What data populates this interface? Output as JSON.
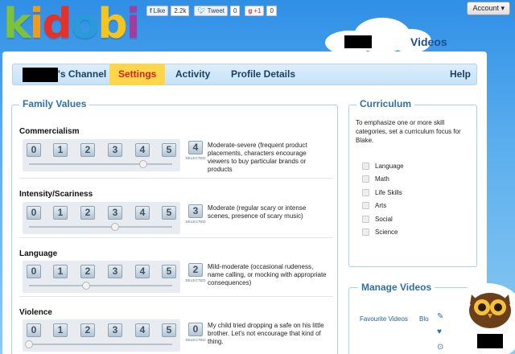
{
  "brand": {
    "letters": [
      "k",
      "i",
      "d",
      "o",
      "b",
      "i"
    ],
    "colors": [
      "#7cc23a",
      "#f29a1d",
      "#e4322b",
      "#2a9ad8",
      "#f4c51f",
      "#a43c9f"
    ]
  },
  "social": {
    "like_label": "Like",
    "like_count": "2.2k",
    "tweet_label": "Tweet",
    "tweet_count": "0",
    "gplus_label": "+1",
    "gplus_count": "0"
  },
  "header": {
    "account_label": "Account ▾",
    "section_title": "Videos"
  },
  "tabs": [
    {
      "label": "'s Channel",
      "active": false
    },
    {
      "label": "Settings",
      "active": true
    },
    {
      "label": "Activity",
      "active": false
    },
    {
      "label": "Profile Details",
      "active": false
    },
    {
      "label": "Help",
      "active": false
    }
  ],
  "family_values": {
    "title": "Family Values",
    "scale_numbers": [
      "0",
      "1",
      "2",
      "3",
      "4",
      "5"
    ],
    "selected_label": "SELECTED",
    "categories": [
      {
        "name": "Commercialism",
        "value": "4",
        "level": 0.8,
        "description": "Moderate-severe (frequent product placements, characters encourage viewers to buy particular brands or products"
      },
      {
        "name": "Intensity/Scariness",
        "value": "3",
        "level": 0.6,
        "description": "Moderate (regular scary or intense scenes, presence of scary music)"
      },
      {
        "name": "Language",
        "value": "2",
        "level": 0.4,
        "description": "Mild-moderate (occasional rudeness, name calling, or mocking with appropriate consequences)"
      },
      {
        "name": "Violence",
        "value": "0",
        "level": 0.0,
        "description": "My child tried dropping a safe on his little brother. Let's not encourage that kind of thing."
      }
    ]
  },
  "curriculum": {
    "title": "Curriculum",
    "intro": "To emphasize one or more skill categories, set a curriculum focus for Blake.",
    "options": [
      "Language",
      "Math",
      "Life Skills",
      "Arts",
      "Social",
      "Science"
    ]
  },
  "manage_videos": {
    "title": "Manage Videos",
    "favourite_label": "Favourite Videos",
    "blocked_label": "Blo"
  },
  "side_icons": [
    "✎",
    "♥",
    "⊙"
  ]
}
